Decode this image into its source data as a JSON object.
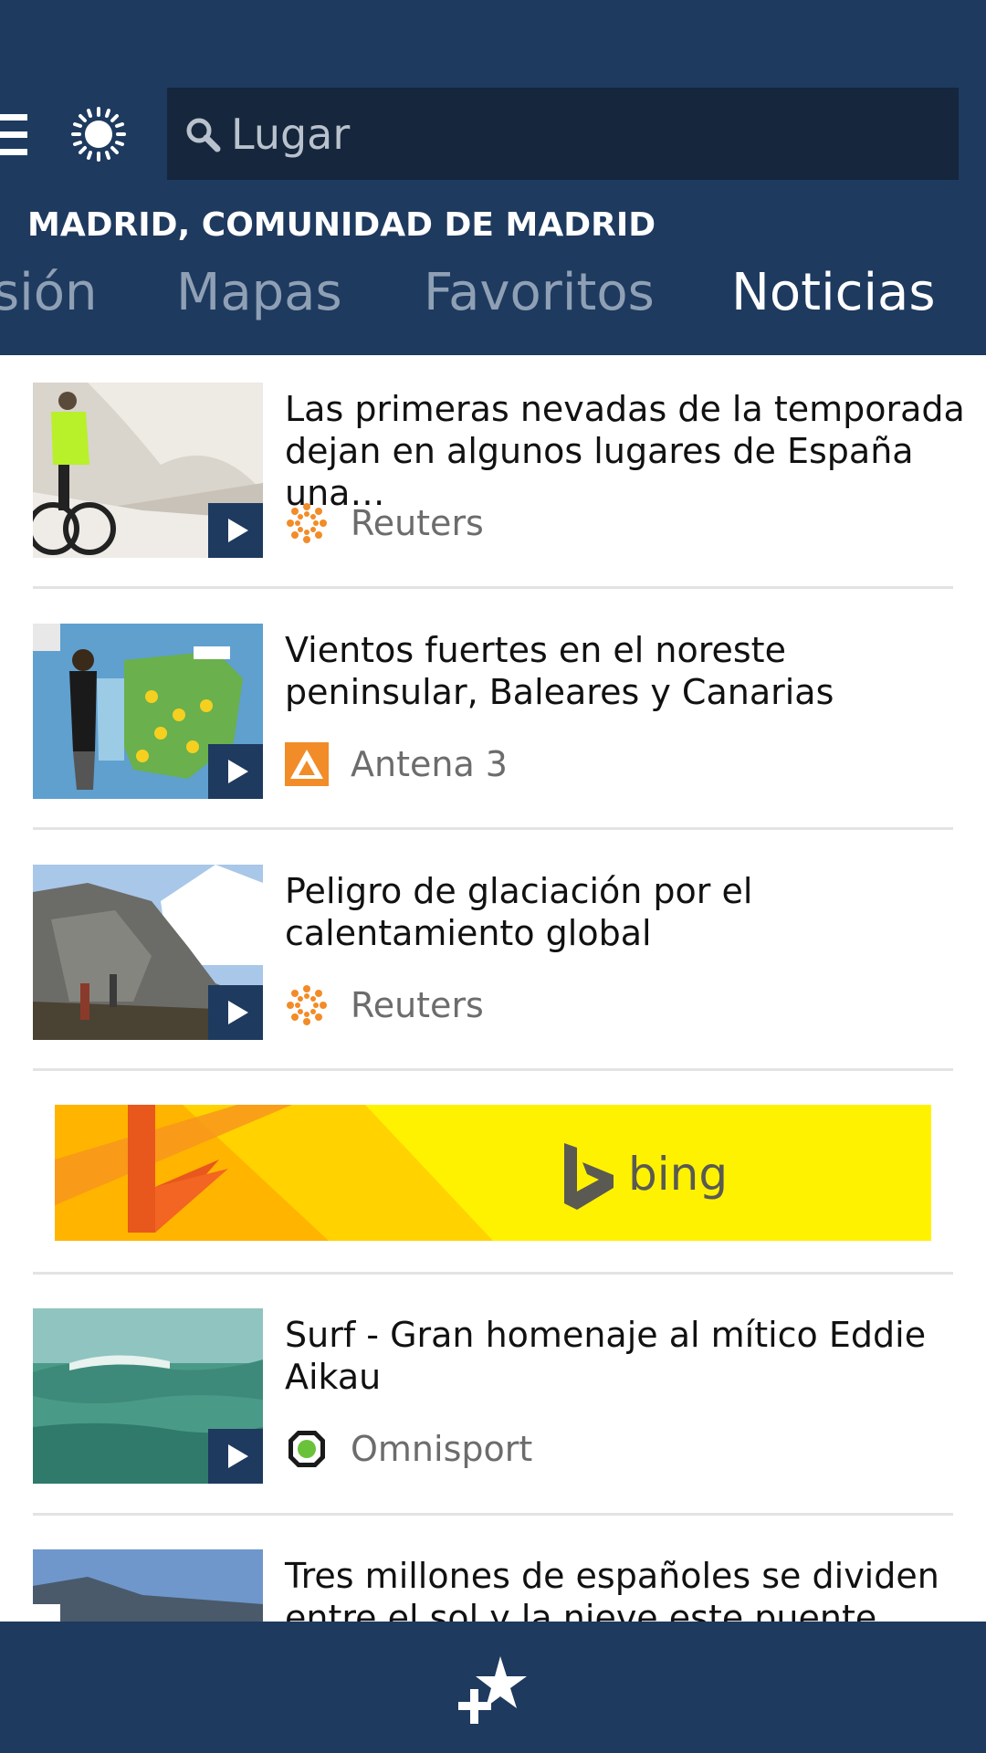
{
  "header": {
    "search": {
      "placeholder": "Lugar"
    },
    "location": "MADRID, COMUNIDAD DE MADRID",
    "tabs": [
      {
        "label": "sión"
      },
      {
        "label": "Mapas"
      },
      {
        "label": "Favoritos"
      },
      {
        "label": "Noticias"
      }
    ],
    "active_tab": "Noticias"
  },
  "news": [
    {
      "headline": "Las primeras nevadas de la temporada dejan en algunos lugares de España una…",
      "source": "Reuters"
    },
    {
      "headline": "Vientos fuertes en el noreste peninsular, Baleares y Canarias",
      "source": "Antena 3"
    },
    {
      "headline": "Peligro de glaciación por el calentamiento global",
      "source": "Reuters"
    },
    {
      "headline": "Surf - Gran homenaje al mítico Eddie Aikau",
      "source": "Omnisport"
    },
    {
      "headline": "Tres millones de españoles se dividen entre el sol y la nieve este puente",
      "source": ""
    }
  ],
  "ad": {
    "brand": "bing"
  },
  "icons": {
    "menu": "hamburger-menu-icon",
    "weather": "sun-icon",
    "search": "search-icon",
    "footer": "pin-to-start-icon"
  },
  "colors": {
    "header_bg": "#1e3a5f",
    "search_bg": "#15263d",
    "tab_inactive": "#8fa0b5",
    "ad_yellow": "#fff200",
    "ad_orange": "#f7931e"
  }
}
